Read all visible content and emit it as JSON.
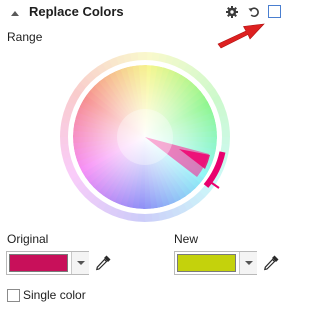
{
  "header": {
    "title": "Replace Colors",
    "icons": [
      "collapse-triangle-icon",
      "gear-icon",
      "reset-icon",
      "enable-checkbox"
    ],
    "enabled": false
  },
  "range": {
    "label": "Range"
  },
  "original": {
    "label": "Original",
    "color": "#c8105a"
  },
  "new_color": {
    "label": "New",
    "color": "#c4d20c"
  },
  "single_color": {
    "label": "Single color",
    "checked": false
  },
  "colors": {
    "annotation_arrow": "#dd2020",
    "checkbox_accent": "#4a7fd0",
    "selection_ring": "#e8006e"
  }
}
